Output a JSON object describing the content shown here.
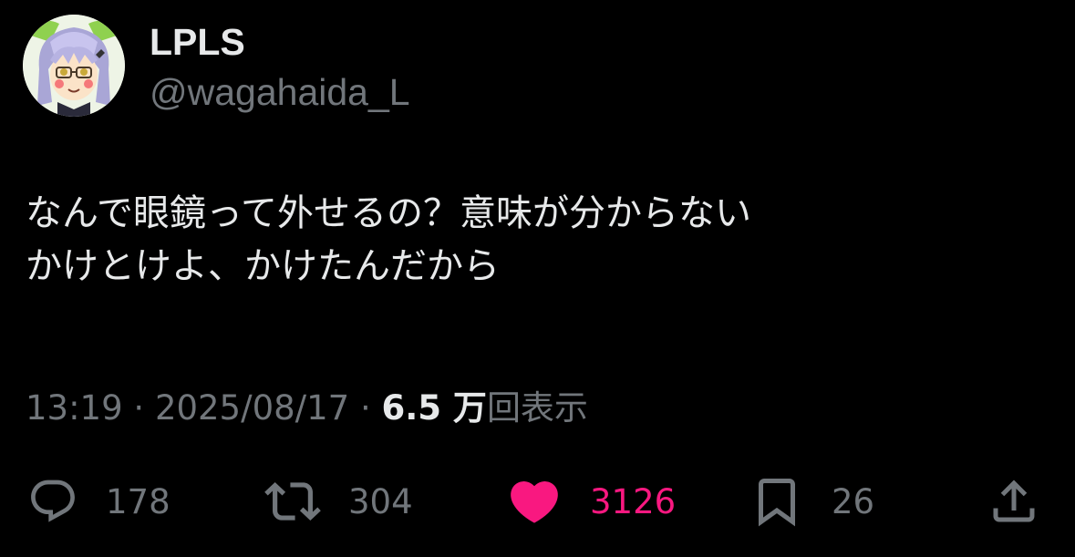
{
  "author": {
    "display_name": "LPLS",
    "handle": "@wagahaida_L",
    "avatar_icon": "anime-character-avatar"
  },
  "tweet": {
    "lines": [
      "なんで眼鏡って外せるの？意味が分からない",
      "かけとけよ、かけたんだから"
    ]
  },
  "meta": {
    "time": "13:19",
    "separator": "·",
    "date": "2025/08/17",
    "views_count": "6.5 万",
    "views_label": "回表示"
  },
  "actions": {
    "reply": {
      "icon": "reply-bubble-icon",
      "count": "178"
    },
    "retweet": {
      "icon": "retweet-icon",
      "count": "304"
    },
    "like": {
      "icon": "heart-icon",
      "count": "3126",
      "liked": true
    },
    "bookmark": {
      "icon": "bookmark-icon",
      "count": "26"
    },
    "share": {
      "icon": "share-icon"
    }
  },
  "colors": {
    "background": "#000000",
    "primary_text": "#e7e9ea",
    "secondary_text": "#71767b",
    "like_pink": "#f91880"
  }
}
